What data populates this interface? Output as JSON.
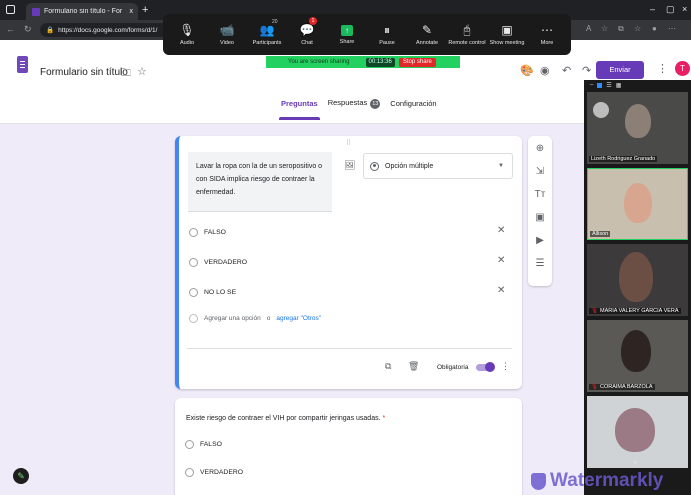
{
  "browser": {
    "tab_title": "Formulario sin título - Formulario",
    "tab_close": "x",
    "new_tab": "+",
    "url": "https://docs.google.com/forms/d/1/"
  },
  "zoom_toolbar": {
    "items": [
      {
        "label": "Audio",
        "icon": "🎙"
      },
      {
        "label": "Video",
        "icon": "📹"
      },
      {
        "label": "Participants",
        "icon": "👥",
        "count": "20"
      },
      {
        "label": "Chat",
        "icon": "💬",
        "badge": "1"
      },
      {
        "label": "Share",
        "icon": "↑"
      },
      {
        "label": "Pause",
        "icon": "⏸"
      },
      {
        "label": "Annotate",
        "icon": "✎"
      },
      {
        "label": "Remote control",
        "icon": "🖰"
      },
      {
        "label": "Show meeting",
        "icon": "▣"
      },
      {
        "label": "More",
        "icon": "⋯"
      }
    ],
    "sharing_text": "You are screen sharing",
    "timer": "00:13:36",
    "stop_label": "Stop share"
  },
  "header": {
    "title": "Formulario sin título",
    "send_label": "Enviar",
    "avatar_letter": "T",
    "tabs": [
      {
        "label": "Preguntas",
        "active": true
      },
      {
        "label": "Respuestas",
        "count": "13"
      },
      {
        "label": "Configuración"
      }
    ]
  },
  "question1": {
    "text": "Lavar la ropa con la de un seropositivo o con SIDA implica riesgo de contraer la enfermedad.",
    "type_label": "Opción múltiple",
    "options": [
      "FALSO",
      "VERDADERO",
      "NO LO SE"
    ],
    "add_option": "Agregar una opción",
    "or_text": "o",
    "add_other": "agregar \"Otros\"",
    "required_label": "Obligatoria",
    "required_on": true
  },
  "question2": {
    "text": "Existe riesgo de contraer el VIH por compartir jeringas usadas.",
    "required_mark": "*",
    "options": [
      "FALSO",
      "VERDADERO"
    ]
  },
  "gallery": {
    "participants": [
      {
        "name": "Lizeth Rodriguez Granado",
        "muted": false
      },
      {
        "name": "Allison",
        "muted": false,
        "active": true
      },
      {
        "name": "MARIA VALERY GARCIA VERA",
        "muted": true
      },
      {
        "name": "CORAIMA BARZOLA",
        "muted": true
      },
      {
        "name": "",
        "muted": false
      }
    ]
  },
  "watermark": "Watermarkly",
  "colors": {
    "forms_purple": "#673ab7",
    "page_bg": "#f0ebf8",
    "focus_blue": "#4285f4",
    "share_green": "#23d160"
  }
}
